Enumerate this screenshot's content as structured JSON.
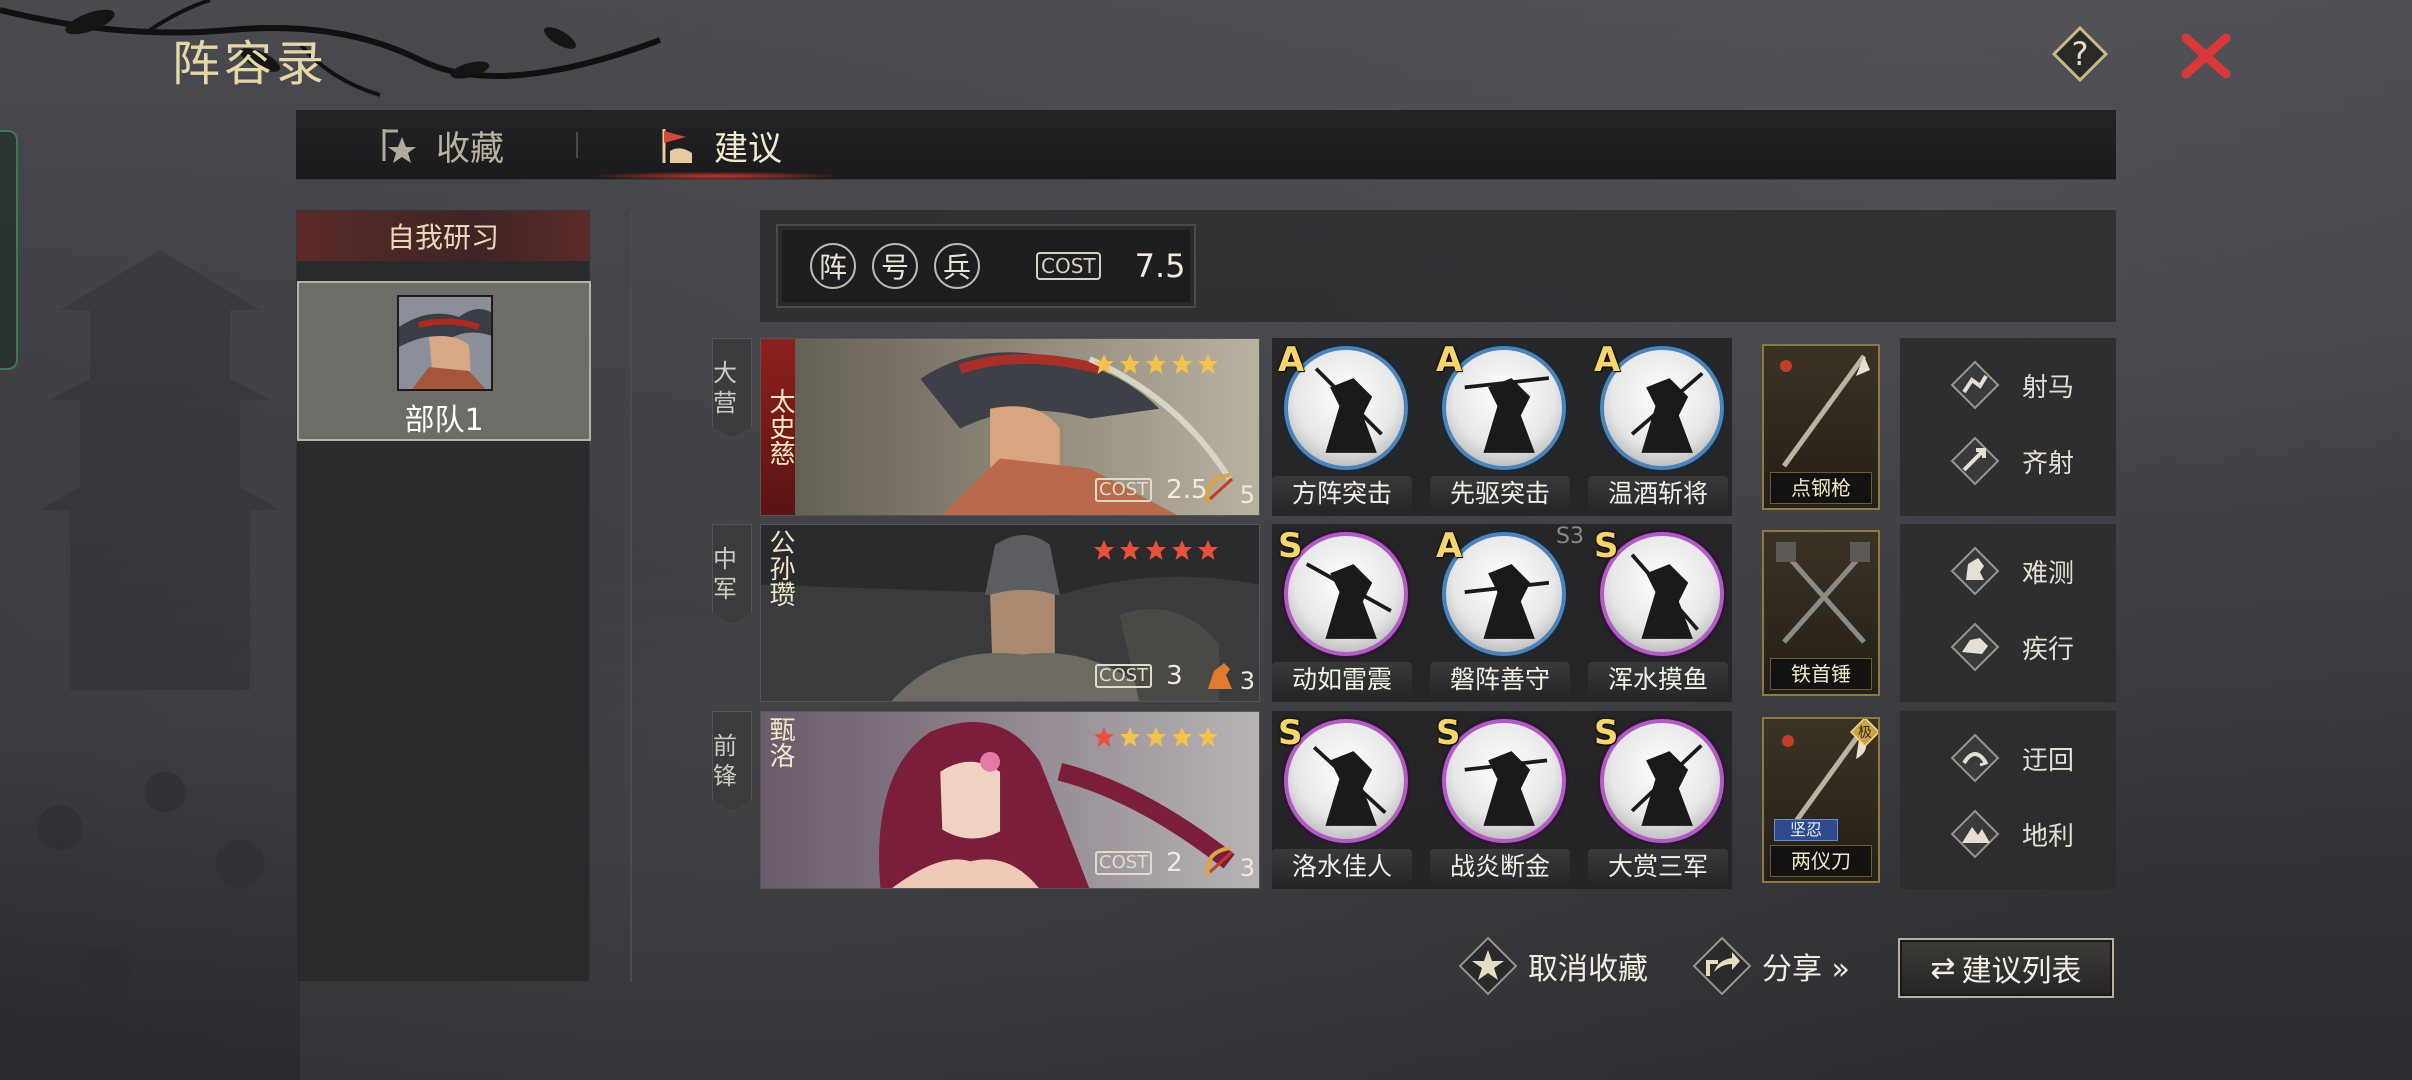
{
  "title": "阵容录",
  "tabs": [
    {
      "label": "收藏",
      "active": false
    },
    {
      "label": "建议",
      "active": true
    }
  ],
  "left_panel": {
    "header": "自我研习",
    "troop_label": "部队1"
  },
  "stats": {
    "icons": [
      "阵",
      "号",
      "兵"
    ],
    "cost_label": "COST",
    "cost_value": "7.5"
  },
  "rows": [
    {
      "position": "大营",
      "hero_name": "太史慈",
      "stars": 5,
      "cost": "2.5",
      "level": "5",
      "skills": [
        {
          "grade": "A",
          "name": "方阵突击"
        },
        {
          "grade": "A",
          "name": "先驱突击"
        },
        {
          "grade": "A",
          "name": "温酒斩将"
        }
      ],
      "season_tag": "",
      "weapon": "点钢枪",
      "tactics": [
        "射马",
        "齐射"
      ]
    },
    {
      "position": "中军",
      "hero_name": "公孙瓒",
      "stars": 5,
      "cost": "3",
      "level": "3",
      "skills": [
        {
          "grade": "S",
          "name": "动如雷震"
        },
        {
          "grade": "A",
          "name": "磐阵善守"
        },
        {
          "grade": "S",
          "name": "浑水摸鱼"
        }
      ],
      "season_tag": "S3",
      "weapon": "铁首锤",
      "tactics": [
        "难测",
        "疾行"
      ]
    },
    {
      "position": "前锋",
      "hero_name": "甄洛",
      "stars": 5,
      "cost": "2",
      "level": "3",
      "skills": [
        {
          "grade": "S",
          "name": "洛水佳人"
        },
        {
          "grade": "S",
          "name": "战炎断金"
        },
        {
          "grade": "S",
          "name": "大赏三军"
        }
      ],
      "season_tag": "",
      "weapon": "两仪刀",
      "weapon_tag": "坚忍",
      "weapon_mark": "极",
      "tactics": [
        "迂回",
        "地利"
      ]
    }
  ],
  "actions": {
    "unfavorite": "取消收藏",
    "share": "分享 »",
    "suggest_list": "建议列表",
    "suggest_list_icon": "⇄"
  },
  "colors": {
    "accent_gold": "#e7d6a6",
    "close_red": "#d9383a",
    "skill_ring_blue": "#4c83b8",
    "skill_ring_purple": "#b35bc4"
  }
}
